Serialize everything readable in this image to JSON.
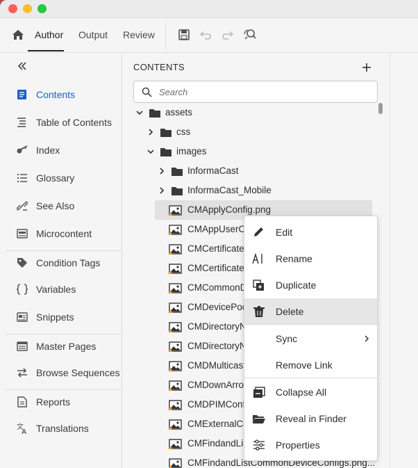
{
  "toolbar": {
    "home_icon": "home-icon",
    "tabs": [
      {
        "label": "Author",
        "active": true
      },
      {
        "label": "Output",
        "active": false
      },
      {
        "label": "Review",
        "active": false
      }
    ],
    "tools": [
      "save-icon",
      "undo-icon",
      "redo-icon",
      "find-replace-icon"
    ]
  },
  "sidebar": {
    "collapse_icon": "double-chevron-left-icon",
    "items": [
      {
        "label": "Contents",
        "icon": "contents-icon",
        "active": true
      },
      {
        "label": "Table of Contents",
        "icon": "toc-icon"
      },
      {
        "label": "Index",
        "icon": "key-icon"
      },
      {
        "label": "Glossary",
        "icon": "glossary-icon"
      },
      {
        "label": "See Also",
        "icon": "link-icon"
      },
      {
        "label": "Microcontent",
        "icon": "microcontent-icon"
      },
      {
        "label": "Condition Tags",
        "icon": "tag-icon"
      },
      {
        "label": "Variables",
        "icon": "braces-icon"
      },
      {
        "label": "Snippets",
        "icon": "snippet-icon"
      },
      {
        "label": "Master Pages",
        "icon": "master-page-icon"
      },
      {
        "label": "Browse Sequences",
        "icon": "browse-sequence-icon"
      },
      {
        "label": "Reports",
        "icon": "report-icon"
      },
      {
        "label": "Translations",
        "icon": "translate-icon"
      }
    ]
  },
  "panel": {
    "title": "CONTENTS",
    "search_placeholder": "Search",
    "tree": [
      {
        "label": "assets",
        "type": "folder",
        "expanded": true
      },
      {
        "label": "css",
        "type": "folder",
        "expanded": false
      },
      {
        "label": "images",
        "type": "folder",
        "expanded": true
      },
      {
        "label": "InformaCast",
        "type": "folder",
        "expanded": false
      },
      {
        "label": "InformaCast_Mobile",
        "type": "folder",
        "expanded": false
      },
      {
        "label": "CMApplyConfig.png",
        "type": "image",
        "selected": true
      },
      {
        "label": "CMAppUserCA",
        "type": "image"
      },
      {
        "label": "CMCertificate",
        "type": "image"
      },
      {
        "label": "CMCertificate",
        "type": "image"
      },
      {
        "label": "CMCommonD",
        "type": "image"
      },
      {
        "label": "CMDevicePoo",
        "type": "image"
      },
      {
        "label": "CMDirectoryN",
        "type": "image"
      },
      {
        "label": "CMDirectoryN",
        "type": "image"
      },
      {
        "label": "CMDMulticast",
        "type": "image"
      },
      {
        "label": "CMDownArrov",
        "type": "image"
      },
      {
        "label": "CMDPIMConfi",
        "type": "image"
      },
      {
        "label": "CMExternalCa",
        "type": "image"
      },
      {
        "label": "CMFindandLis",
        "type": "image"
      },
      {
        "label": "CMFindandListCommonDeviceConfigs.png...",
        "type": "image"
      }
    ]
  },
  "context_menu": {
    "items": [
      {
        "label": "Edit",
        "icon": "pencil-icon"
      },
      {
        "label": "Rename",
        "icon": "rename-icon"
      },
      {
        "label": "Duplicate",
        "icon": "duplicate-icon"
      },
      {
        "label": "Delete",
        "icon": "trash-icon",
        "hover": true
      },
      {
        "label": "Sync",
        "icon": "",
        "submenu": true
      },
      {
        "label": "Remove Link",
        "icon": ""
      },
      {
        "label": "Collapse All",
        "icon": "collapse-all-icon"
      },
      {
        "label": "Reveal in Finder",
        "icon": "folder-open-icon"
      },
      {
        "label": "Properties",
        "icon": "sliders-icon"
      }
    ]
  },
  "colors": {
    "accent": "#1a5fc9",
    "traffic_red": "#fe5f57",
    "traffic_yellow": "#febc2e",
    "traffic_green": "#28c840"
  }
}
